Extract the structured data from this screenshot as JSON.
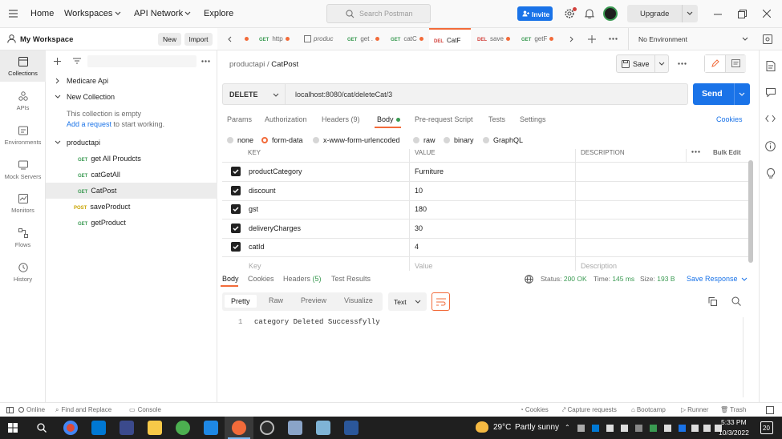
{
  "topbar": {
    "home": "Home",
    "workspaces": "Workspaces",
    "api_network": "API Network",
    "explore": "Explore",
    "search_placeholder": "Search Postman",
    "invite": "Invite",
    "upgrade": "Upgrade"
  },
  "workspace": {
    "title": "My Workspace",
    "new_label": "New",
    "import_label": "Import"
  },
  "rail": [
    {
      "label": "Collections",
      "icon": "collections-icon"
    },
    {
      "label": "APIs",
      "icon": "apis-icon"
    },
    {
      "label": "Environments",
      "icon": "environments-icon"
    },
    {
      "label": "Mock Servers",
      "icon": "mock-servers-icon"
    },
    {
      "label": "Monitors",
      "icon": "monitors-icon"
    },
    {
      "label": "Flows",
      "icon": "flows-icon"
    },
    {
      "label": "History",
      "icon": "history-icon"
    }
  ],
  "tree": {
    "items": [
      {
        "name": "Medicare Api"
      },
      {
        "name": "New Collection"
      },
      {
        "empty_msg": "This collection is empty",
        "add_link": "Add a request",
        "add_suffix": " to start working."
      },
      {
        "name": "productapi"
      },
      {
        "method": "GET",
        "name": "get All Proudcts"
      },
      {
        "method": "GET",
        "name": "catGetAll"
      },
      {
        "method": "GET",
        "name": "CatPost"
      },
      {
        "method": "POST",
        "name": "saveProduct"
      },
      {
        "method": "GET",
        "name": "getProduct"
      }
    ]
  },
  "tabs": [
    {
      "method": "GET",
      "label": "http"
    },
    {
      "method": "",
      "label": "produc"
    },
    {
      "method": "GET",
      "label": "get ."
    },
    {
      "method": "GET",
      "label": "catC"
    },
    {
      "method": "DEL",
      "label": "CatF"
    },
    {
      "method": "DEL",
      "label": "save"
    },
    {
      "method": "GET",
      "label": "getF"
    }
  ],
  "environment": "No Environment",
  "request": {
    "breadcrumb_parent": "productapi",
    "breadcrumb_sep": "/",
    "breadcrumb_name": "CatPost",
    "save_label": "Save",
    "method": "DELETE",
    "url": "localhost:8080/cat/deleteCat/3",
    "send_label": "Send",
    "tabs": {
      "params": "Params",
      "authorization": "Authorization",
      "headers": "Headers (9)",
      "body": "Body",
      "prerequest": "Pre-request Script",
      "tests": "Tests",
      "settings": "Settings",
      "cookies": "Cookies"
    },
    "body_types": {
      "none": "none",
      "form_data": "form-data",
      "urlencoded": "x-www-form-urlencoded",
      "raw": "raw",
      "binary": "binary",
      "graphql": "GraphQL"
    },
    "table": {
      "headers": {
        "key": "KEY",
        "value": "VALUE",
        "description": "DESCRIPTION",
        "bulk": "Bulk Edit"
      },
      "rows": [
        {
          "key": "productCategory",
          "value": "Furniture"
        },
        {
          "key": "discount",
          "value": "10"
        },
        {
          "key": "gst",
          "value": "180"
        },
        {
          "key": "deliveryCharges",
          "value": "30"
        },
        {
          "key": "catId",
          "value": "4"
        }
      ],
      "placeholder": {
        "key": "Key",
        "value": "Value",
        "description": "Description"
      }
    }
  },
  "response": {
    "tabs": {
      "body": "Body",
      "cookies": "Cookies",
      "headers_prefix": "Headers ",
      "headers_count": "(5)",
      "test_results": "Test Results"
    },
    "status_label": "Status:",
    "status_value": "200 OK",
    "time_label": "Time:",
    "time_value": "145 ms",
    "size_label": "Size:",
    "size_value": "193 B",
    "save_response": "Save Response",
    "views": {
      "pretty": "Pretty",
      "raw": "Raw",
      "preview": "Preview",
      "visualize": "Visualize"
    },
    "format": "Text",
    "line_number": "1",
    "line_text": "category Deleted Successfylly"
  },
  "statusbar": {
    "online": "Online",
    "find_replace": "Find and Replace",
    "console": "Console",
    "cookies": "Cookies",
    "capture": "Capture requests",
    "bootcamp": "Bootcamp",
    "runner": "Runner",
    "trash": "Trash"
  },
  "taskbar": {
    "weather_temp": "29°C",
    "weather_desc": "Partly sunny",
    "time": "5:33 PM",
    "date": "10/3/2022",
    "notifications": "20"
  },
  "colors": {
    "accent": "#f26b3a",
    "primary": "#1a73e8",
    "get": "#3a9a52",
    "post": "#c9a400",
    "delete": "#d2413c"
  }
}
